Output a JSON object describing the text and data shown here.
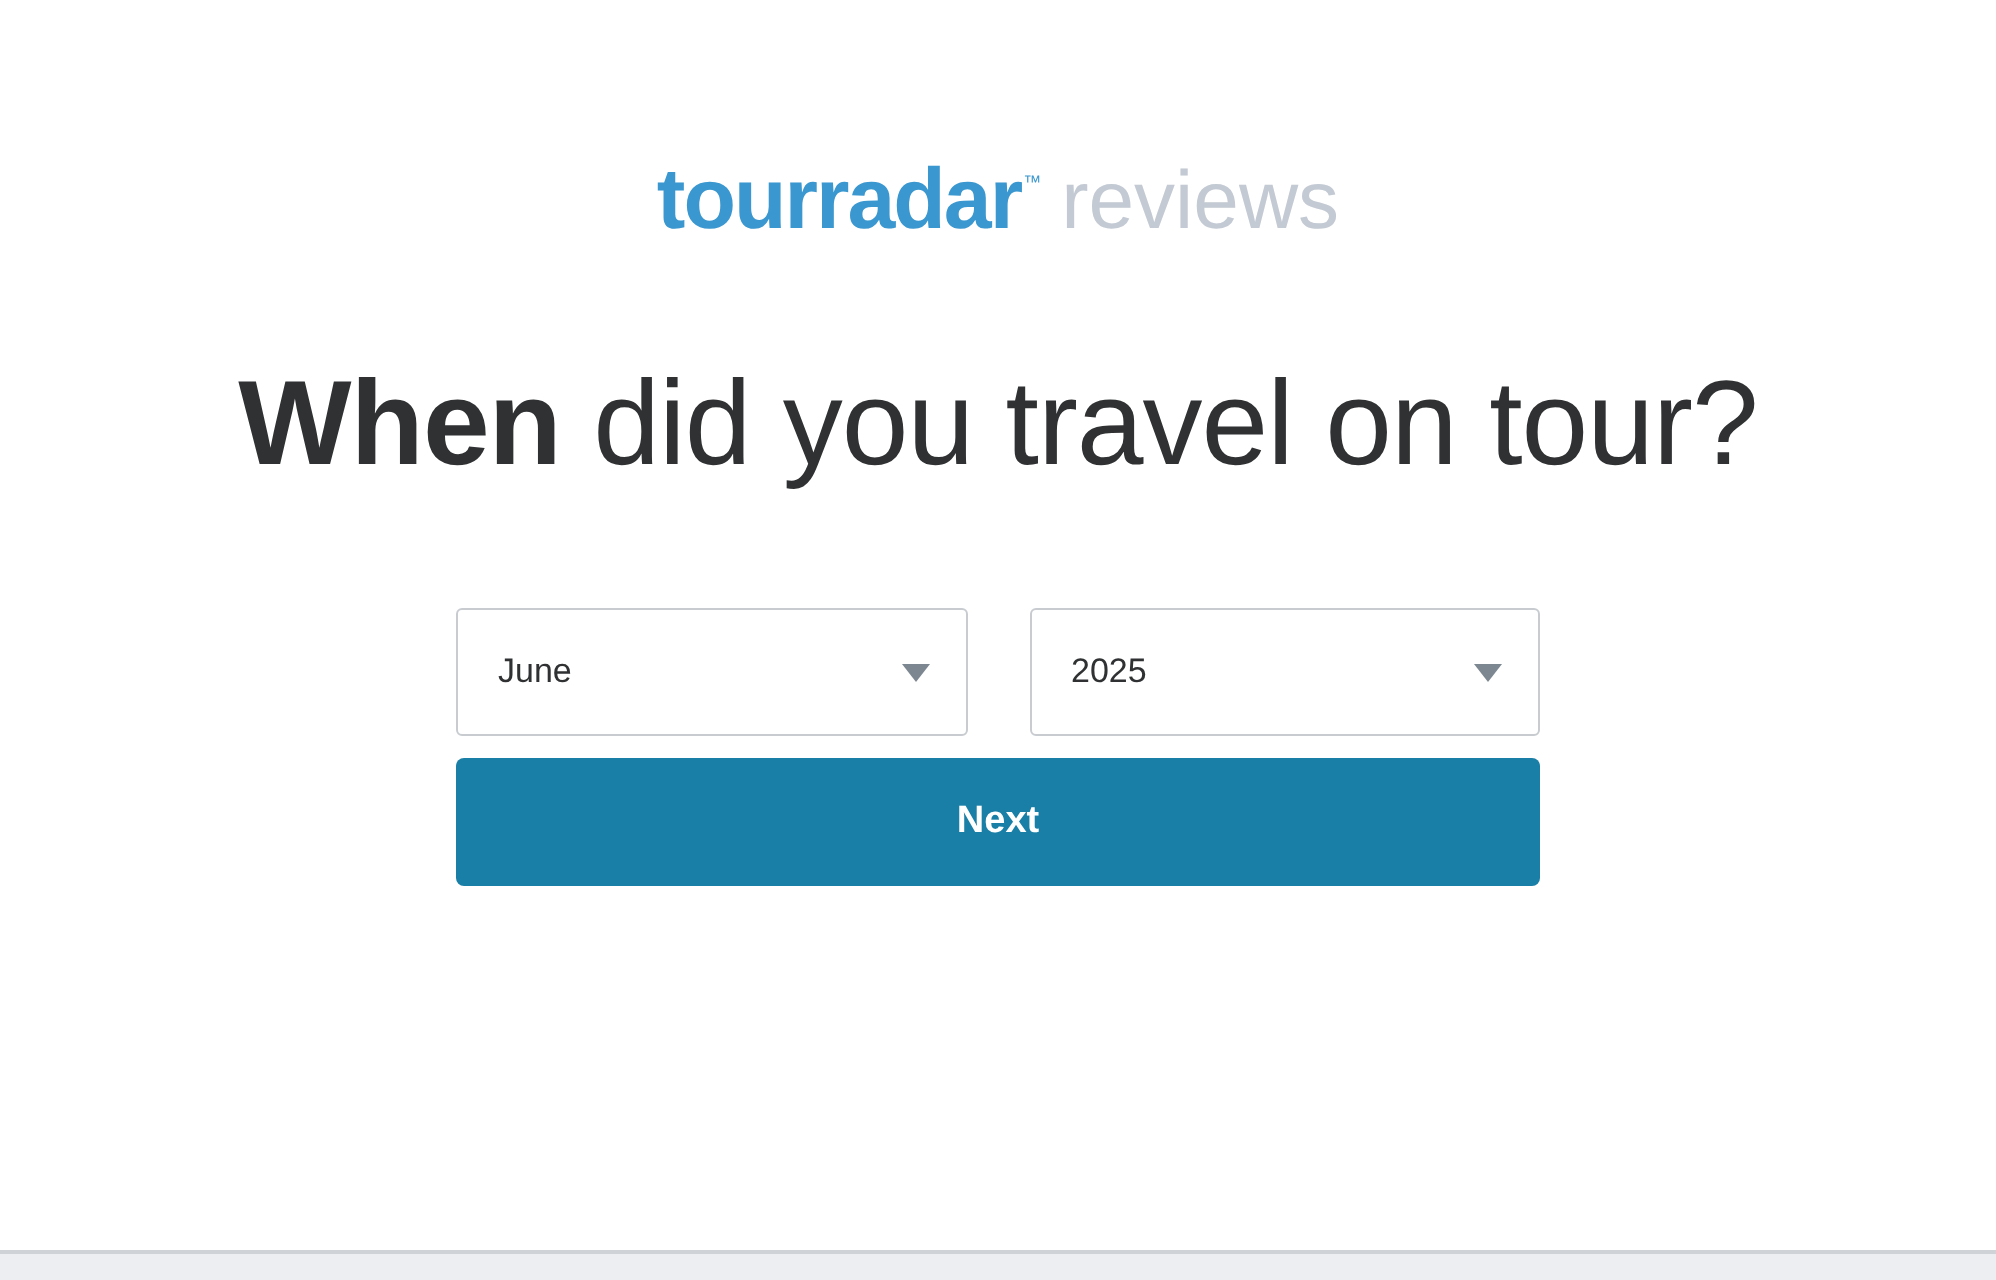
{
  "logo": {
    "brand": "tourradar",
    "trademark": "™",
    "suffix": "reviews"
  },
  "question": "**When** did you travel on tour?",
  "selects": [
    {
      "value": "June"
    },
    {
      "value": "2025"
    }
  ],
  "button": {
    "label": "Next"
  }
}
